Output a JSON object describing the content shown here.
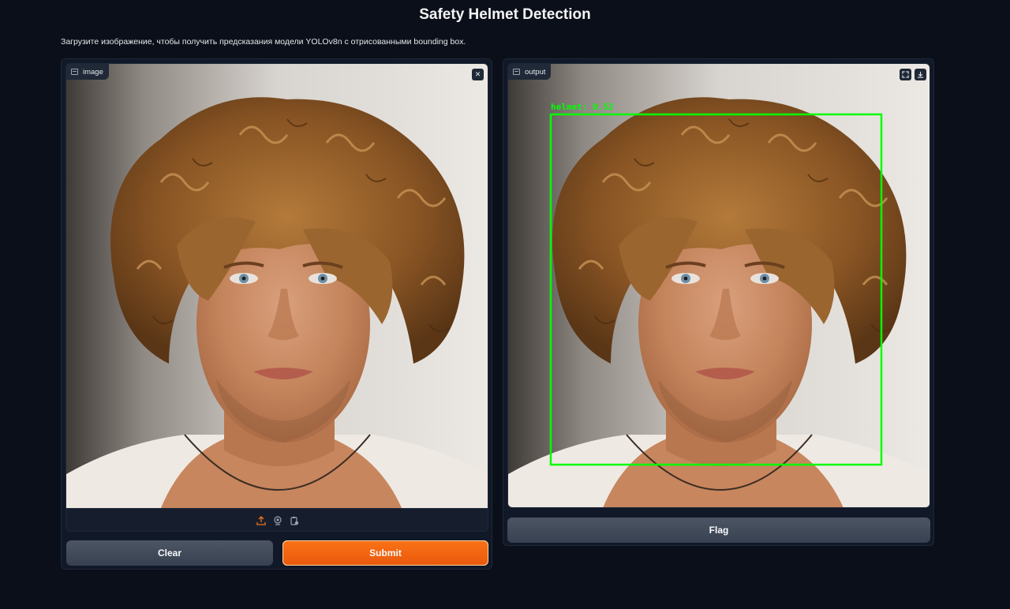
{
  "page": {
    "title": "Safety Helmet Detection",
    "description": "Загрузите изображение, чтобы получить предсказания модели YOLOv8n с отрисованными bounding box."
  },
  "input_panel": {
    "label": "image",
    "label_icon": "image-icon",
    "close_icon": "close-icon",
    "toolbar_icons": [
      "upload-icon",
      "webcam-icon",
      "clipboard-icon"
    ],
    "clear_label": "Clear",
    "submit_label": "Submit"
  },
  "output_panel": {
    "label": "output",
    "label_icon": "image-icon",
    "corner_icons": [
      "fullscreen-icon",
      "download-icon"
    ],
    "detection_label": "helmet: 0.52",
    "detection_color": "#00ff00",
    "flag_label": "Flag"
  },
  "colors": {
    "background": "#0b0f19",
    "panel": "#111827",
    "primary_button": "#f97316",
    "secondary_button": "#4b5563"
  }
}
